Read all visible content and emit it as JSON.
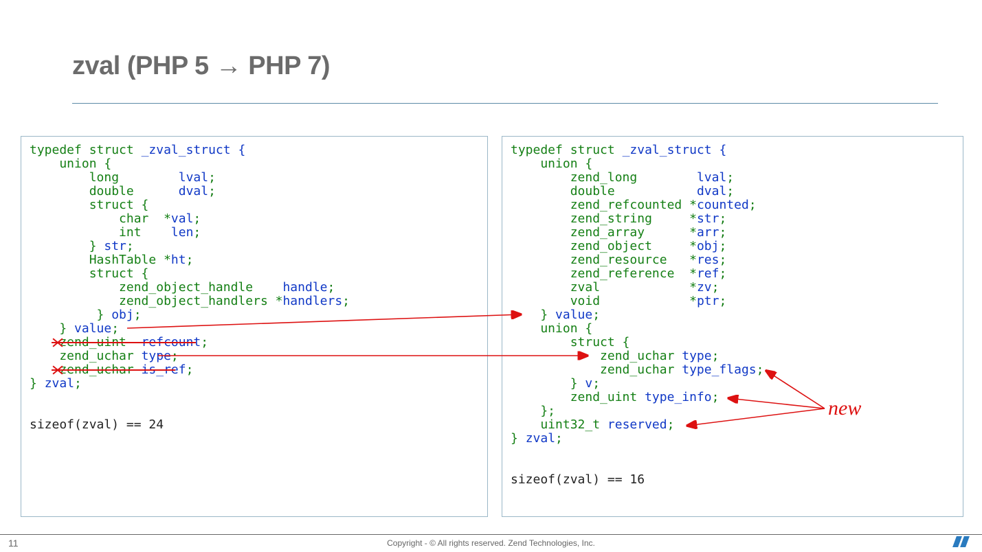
{
  "title": "zval (PHP 5 → PHP 7)",
  "pagenum": "11",
  "copyright": "Copyright - © All rights reserved. Zend Technologies, Inc.",
  "new_label": "new",
  "left": {
    "l1_kw": "typedef struct ",
    "l1_id": "_zval_struct {",
    "l2": "    union {",
    "l3_kw": "        long        ",
    "l3_id": "lval",
    "l3_p": ";",
    "l4_kw": "        double      ",
    "l4_id": "dval",
    "l4_p": ";",
    "l5": "        struct {",
    "l6_kw": "            char  *",
    "l6_id": "val",
    "l6_p": ";",
    "l7_kw": "            int    ",
    "l7_id": "len",
    "l7_p": ";",
    "l8_kw": "        } ",
    "l8_id": "str",
    "l8_p": ";",
    "l9_kw": "        HashTable *",
    "l9_id": "ht",
    "l9_p": ";",
    "l10": "        struct {",
    "l11_kw": "            zend_object_handle    ",
    "l11_id": "handle",
    "l11_p": ";",
    "l12_kw": "            zend_object_handlers *",
    "l12_id": "handlers",
    "l12_p": ";",
    "l13_kw": "         } ",
    "l13_id": "obj",
    "l13_p": ";",
    "l14_kw": "    } ",
    "l14_id": "value",
    "l14_p": ";",
    "l15_kw": "    zend_uint  ",
    "l15_id": "refcount",
    "l15_p": ";",
    "l16_kw": "    zend_uchar ",
    "l16_id": "type",
    "l16_p": ";",
    "l17_kw": "    zend_uchar ",
    "l17_id": "is_ref",
    "l17_p": ";",
    "l18_kw": "} ",
    "l18_id": "zval",
    "l18_p": ";",
    "size": "sizeof(zval) == 24"
  },
  "right": {
    "l1_kw": "typedef struct ",
    "l1_id": "_zval_struct {",
    "l2": "    union {",
    "l3_kw": "        zend_long        ",
    "l3_id": "lval",
    "l3_p": ";",
    "l4_kw": "        double           ",
    "l4_id": "dval",
    "l4_p": ";",
    "l5_kw": "        zend_refcounted *",
    "l5_id": "counted",
    "l5_p": ";",
    "l6_kw": "        zend_string     *",
    "l6_id": "str",
    "l6_p": ";",
    "l7_kw": "        zend_array      *",
    "l7_id": "arr",
    "l7_p": ";",
    "l8_kw": "        zend_object     *",
    "l8_id": "obj",
    "l8_p": ";",
    "l9_kw": "        zend_resource   *",
    "l9_id": "res",
    "l9_p": ";",
    "l10_kw": "        zend_reference  *",
    "l10_id": "ref",
    "l10_p": ";",
    "l11_kw": "        zval            *",
    "l11_id": "zv",
    "l11_p": ";",
    "l12_kw": "        void            *",
    "l12_id": "ptr",
    "l12_p": ";",
    "l13_kw": "    } ",
    "l13_id": "value",
    "l13_p": ";",
    "l14": "    union {",
    "l15": "        struct {",
    "l16_kw": "            zend_uchar ",
    "l16_id": "type",
    "l16_p": ";",
    "l17_kw": "            zend_uchar ",
    "l17_id": "type_flags",
    "l17_p": ";",
    "l18_kw": "        } ",
    "l18_id": "v",
    "l18_p": ";",
    "l19_kw": "        zend_uint ",
    "l19_id": "type_info",
    "l19_p": ";",
    "l20": "    };",
    "l21_kw": "    uint32_t ",
    "l21_id": "reserved",
    "l21_p": ";",
    "l22_kw": "} ",
    "l22_id": "zval",
    "l22_p": ";",
    "size": "sizeof(zval) == 16"
  }
}
